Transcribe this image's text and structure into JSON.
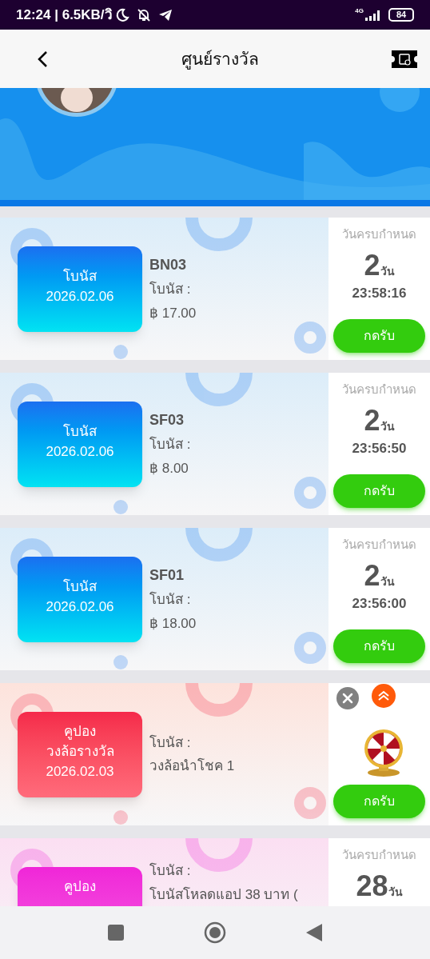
{
  "status_bar": {
    "time": "12:24 | 6.5KB/วิ",
    "network": "4G",
    "battery": "84"
  },
  "header": {
    "title": "ศูนย์รางวัล"
  },
  "rewards": [
    {
      "color": "#1a78f0",
      "badge": [
        "โบนัส",
        "2026.02.06"
      ],
      "code": "BN03",
      "lines": [
        "โบนัส :",
        "฿ 17.00"
      ],
      "deadline": {
        "label": "วันครบกำหนด",
        "days": "2",
        "unit": "วัน",
        "time": "23:58:16"
      },
      "button": "กดรับ"
    },
    {
      "color": "#1a78f0",
      "badge": [
        "โบนัส",
        "2026.02.06"
      ],
      "code": "SF03",
      "lines": [
        "โบนัส :",
        "฿ 8.00"
      ],
      "deadline": {
        "label": "วันครบกำหนด",
        "days": "2",
        "unit": "วัน",
        "time": "23:56:50"
      },
      "button": "กดรับ"
    },
    {
      "color": "#1a78f0",
      "badge": [
        "โบนัส",
        "2026.02.06"
      ],
      "code": "SF01",
      "lines": [
        "โบนัส :",
        "฿ 18.00"
      ],
      "deadline": {
        "label": "วันครบกำหนด",
        "days": "2",
        "unit": "วัน",
        "time": "23:56:00"
      },
      "button": "กดรับ"
    },
    {
      "color": "#f52c4a",
      "badge": [
        "คูปอง",
        "วงล้อรางวัล",
        "2026.02.03"
      ],
      "lines": [
        "โบนัส :",
        "วงล้อนำโชค 1"
      ],
      "button": "กดรับ",
      "overlay": true
    },
    {
      "color": "#f02ad8",
      "badge": [
        "คูปอง"
      ],
      "lines": [
        "โบนัส :",
        "โบนัสโหลดแอป 38 บาท ("
      ],
      "truncated": true,
      "deadline": {
        "label": "วันครบกำหนด",
        "days": "28",
        "unit": "วัน"
      }
    }
  ]
}
